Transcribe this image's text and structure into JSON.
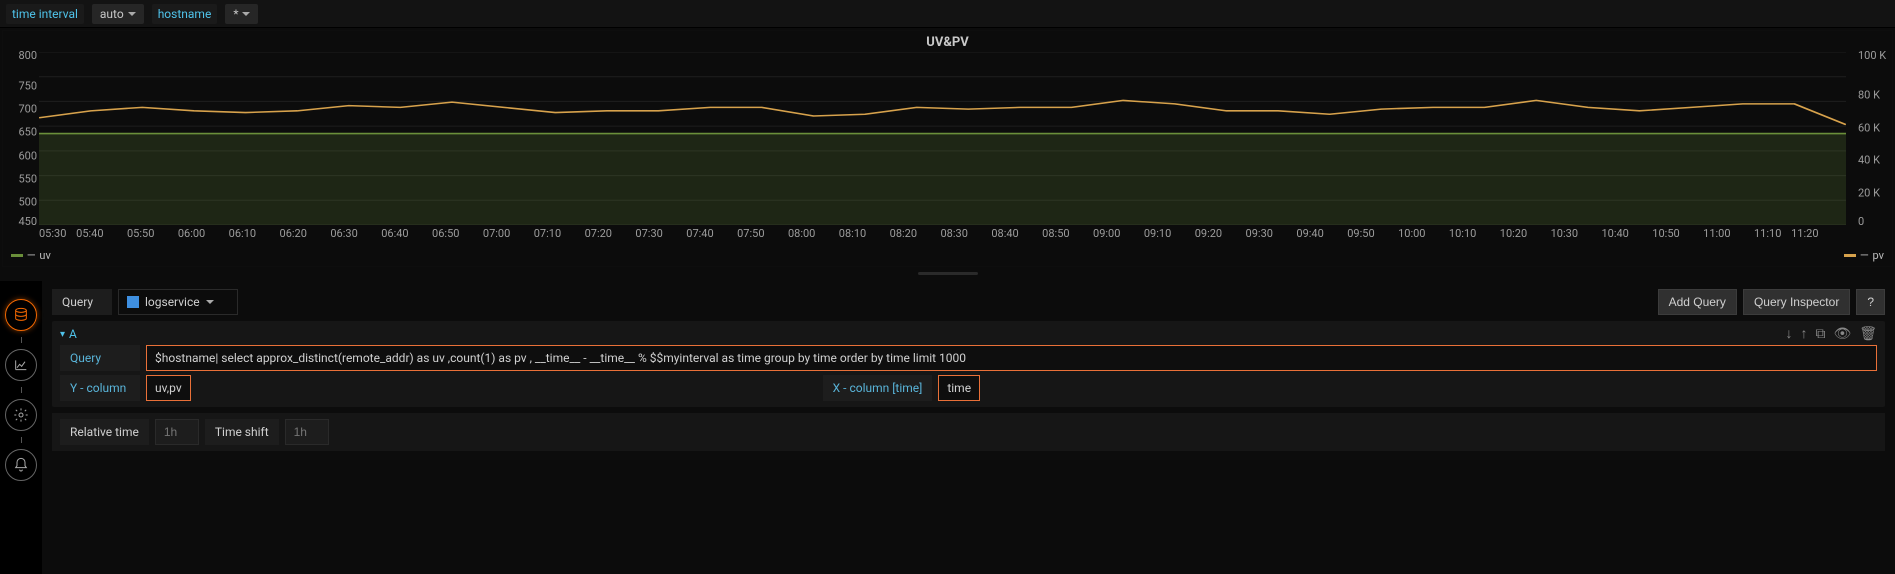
{
  "template_vars": {
    "time_interval_label": "time interval",
    "time_interval_value": "auto",
    "hostname_label": "hostname",
    "hostname_value": "*"
  },
  "panel": {
    "title": "UV&PV"
  },
  "legend": {
    "uv": "uv",
    "pv": "pv"
  },
  "chart_data": {
    "type": "line",
    "title": "UV&PV",
    "x_ticks": [
      "05:30",
      "05:40",
      "05:50",
      "06:00",
      "06:10",
      "06:20",
      "06:30",
      "06:40",
      "06:50",
      "07:00",
      "07:10",
      "07:20",
      "07:30",
      "07:40",
      "07:50",
      "08:00",
      "08:10",
      "08:20",
      "08:30",
      "08:40",
      "08:50",
      "09:00",
      "09:10",
      "09:20",
      "09:30",
      "09:40",
      "09:50",
      "10:00",
      "10:10",
      "10:20",
      "10:30",
      "10:40",
      "10:50",
      "11:00",
      "11:10",
      "11:20"
    ],
    "y_left_ticks": [
      "800",
      "750",
      "700",
      "650",
      "600",
      "550",
      "500",
      "450"
    ],
    "y_right_ticks": [
      "100 K",
      "80 K",
      "60 K",
      "40 K",
      "20 K",
      "0"
    ],
    "y_left_range": [
      450,
      800
    ],
    "y_right_range": [
      0,
      100000
    ],
    "series": [
      {
        "name": "uv",
        "axis": "left",
        "color": "#6a8f3a",
        "fill": "rgba(106,143,58,0.20)",
        "values": [
          635,
          635,
          635,
          635,
          635,
          635,
          635,
          635,
          635,
          635,
          635,
          635,
          635,
          635,
          635,
          635,
          635,
          635,
          635,
          635,
          635,
          635,
          635,
          635,
          635,
          635,
          635,
          635,
          635,
          635,
          635,
          635,
          635,
          635,
          635,
          635
        ]
      },
      {
        "name": "pv",
        "axis": "right",
        "color": "#d7a24c",
        "fill": "none",
        "values": [
          62000,
          66000,
          68000,
          66000,
          65000,
          66000,
          69000,
          68000,
          71000,
          68000,
          65000,
          66000,
          66000,
          68000,
          68000,
          63000,
          64000,
          68000,
          67000,
          68000,
          68000,
          72000,
          70000,
          66000,
          66000,
          64000,
          67000,
          68000,
          68000,
          72000,
          68000,
          66000,
          68000,
          70000,
          70000,
          58000
        ]
      }
    ]
  },
  "query_row": {
    "label": "Query",
    "datasource": "logservice",
    "add_query_btn": "Add Query",
    "inspector_btn": "Query Inspector",
    "help_btn": "?"
  },
  "queryA": {
    "letter": "A",
    "query_label": "Query",
    "query_text": "$hostname| select approx_distinct(remote_addr) as uv ,count(1) as pv , __time__ - __time__ % $$myinterval as time group by time order by time limit 1000",
    "y_label": "Y - column",
    "y_value": "uv,pv",
    "x_label": "X - column [time]",
    "x_value": "time"
  },
  "time_opts": {
    "relative_label": "Relative time",
    "relative_placeholder": "1h",
    "shift_label": "Time shift",
    "shift_placeholder": "1h"
  }
}
